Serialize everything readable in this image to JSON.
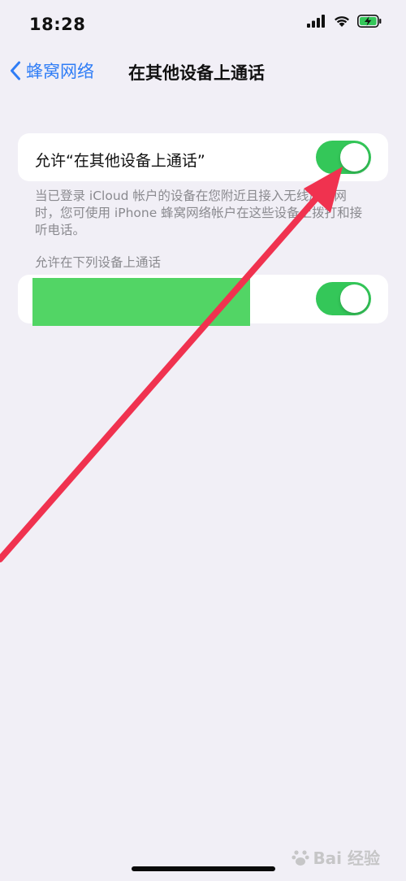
{
  "status_bar": {
    "time": "18:28",
    "icons": [
      "signal-icon",
      "wifi-icon",
      "battery-charging-icon"
    ]
  },
  "nav": {
    "back_label": "蜂窝网络",
    "title": "在其他设备上通话"
  },
  "main_group": {
    "label": "允许“在其他设备上通话”",
    "toggle_on": true,
    "footer": "当已登录 iCloud 帐户的设备在您附近且接入无线局域网时，您可使用 iPhone 蜂窝网络帐户在这些设备上拨打和接听电话。"
  },
  "devices_section": {
    "header": "允许在下列设备上通话",
    "toggle_on": true
  },
  "watermark": {
    "text": "Bai 经验"
  },
  "colors": {
    "accent": "#2f7df6",
    "toggle_on": "#34c759",
    "arrow": "#f0324f",
    "background": "#f1eff6"
  }
}
